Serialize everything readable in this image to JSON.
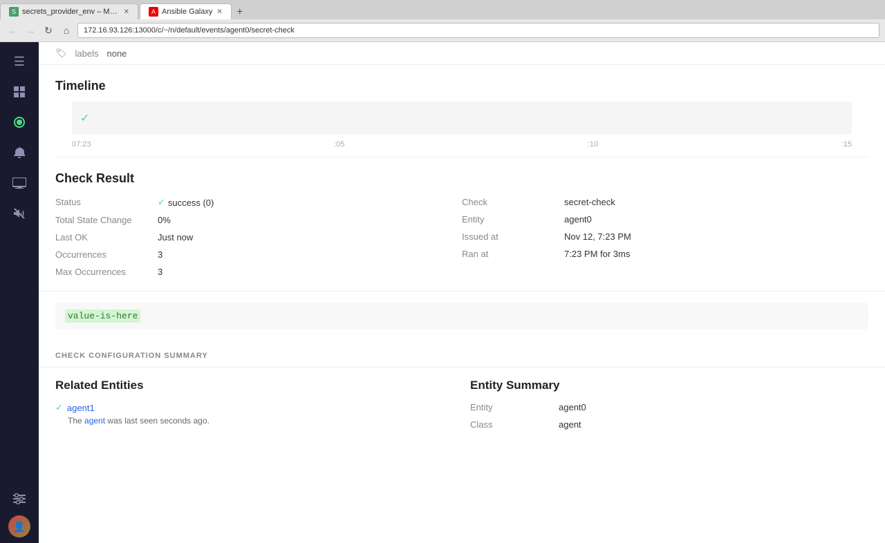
{
  "browser": {
    "tabs": [
      {
        "id": "sensu",
        "favicon": "S",
        "label": "secrets_provider_env – Manage Se...",
        "active": false,
        "closeable": true
      },
      {
        "id": "ansible",
        "favicon": "A",
        "label": "Ansible Galaxy",
        "active": false,
        "closeable": true
      }
    ],
    "address": "172.16.93.126:13000/c/~/n/default/events/agent0/secret-check",
    "new_tab": "+"
  },
  "sidebar": {
    "logo": "S",
    "icons": [
      {
        "name": "menu-icon",
        "symbol": "☰",
        "active": false
      },
      {
        "name": "dashboard-icon",
        "symbol": "⊞",
        "active": false
      },
      {
        "name": "circle-icon",
        "symbol": "◉",
        "active": true
      },
      {
        "name": "bell-icon",
        "symbol": "🔔",
        "active": false
      },
      {
        "name": "monitor-icon",
        "symbol": "🖥",
        "active": false
      },
      {
        "name": "mute-icon",
        "symbol": "🔇",
        "active": false
      },
      {
        "name": "settings-icon",
        "symbol": "⚙",
        "active": false
      }
    ]
  },
  "labels_bar": {
    "icon": "🏷",
    "key": "labels",
    "value": "none"
  },
  "timeline": {
    "title": "Timeline",
    "check_icon": "✓",
    "ticks": [
      "07:23",
      ":05",
      ":10",
      ":15"
    ]
  },
  "check_result": {
    "title": "Check Result",
    "left": [
      {
        "label": "Status",
        "value": "success (0)",
        "icon": "✓",
        "icon_color": "#4ade80"
      },
      {
        "label": "Total State Change",
        "value": "0%"
      },
      {
        "label": "Last OK",
        "value": "Just now"
      },
      {
        "label": "Occurrences",
        "value": "3"
      },
      {
        "label": "Max Occurrences",
        "value": "3"
      }
    ],
    "right": [
      {
        "label": "Check",
        "value": "secret-check"
      },
      {
        "label": "Entity",
        "value": "agent0"
      },
      {
        "label": "Issued at",
        "value": "Nov 12, 7:23 PM"
      },
      {
        "label": "Ran at",
        "value": "7:23 PM for 3ms"
      }
    ]
  },
  "output": {
    "text": "value-is-here"
  },
  "config_summary": {
    "title": "CHECK CONFIGURATION SUMMARY"
  },
  "related_entities": {
    "title": "Related Entities",
    "items": [
      {
        "name": "agent1",
        "check_icon": "✓",
        "description_prefix": "The",
        "description_keyword": "agent",
        "description_suffix": "was last seen",
        "description_time": "seconds ago."
      }
    ]
  },
  "entity_summary": {
    "title": "Entity Summary",
    "rows": [
      {
        "label": "Entity",
        "value": "agent0"
      },
      {
        "label": "Class",
        "value": "agent"
      }
    ]
  }
}
